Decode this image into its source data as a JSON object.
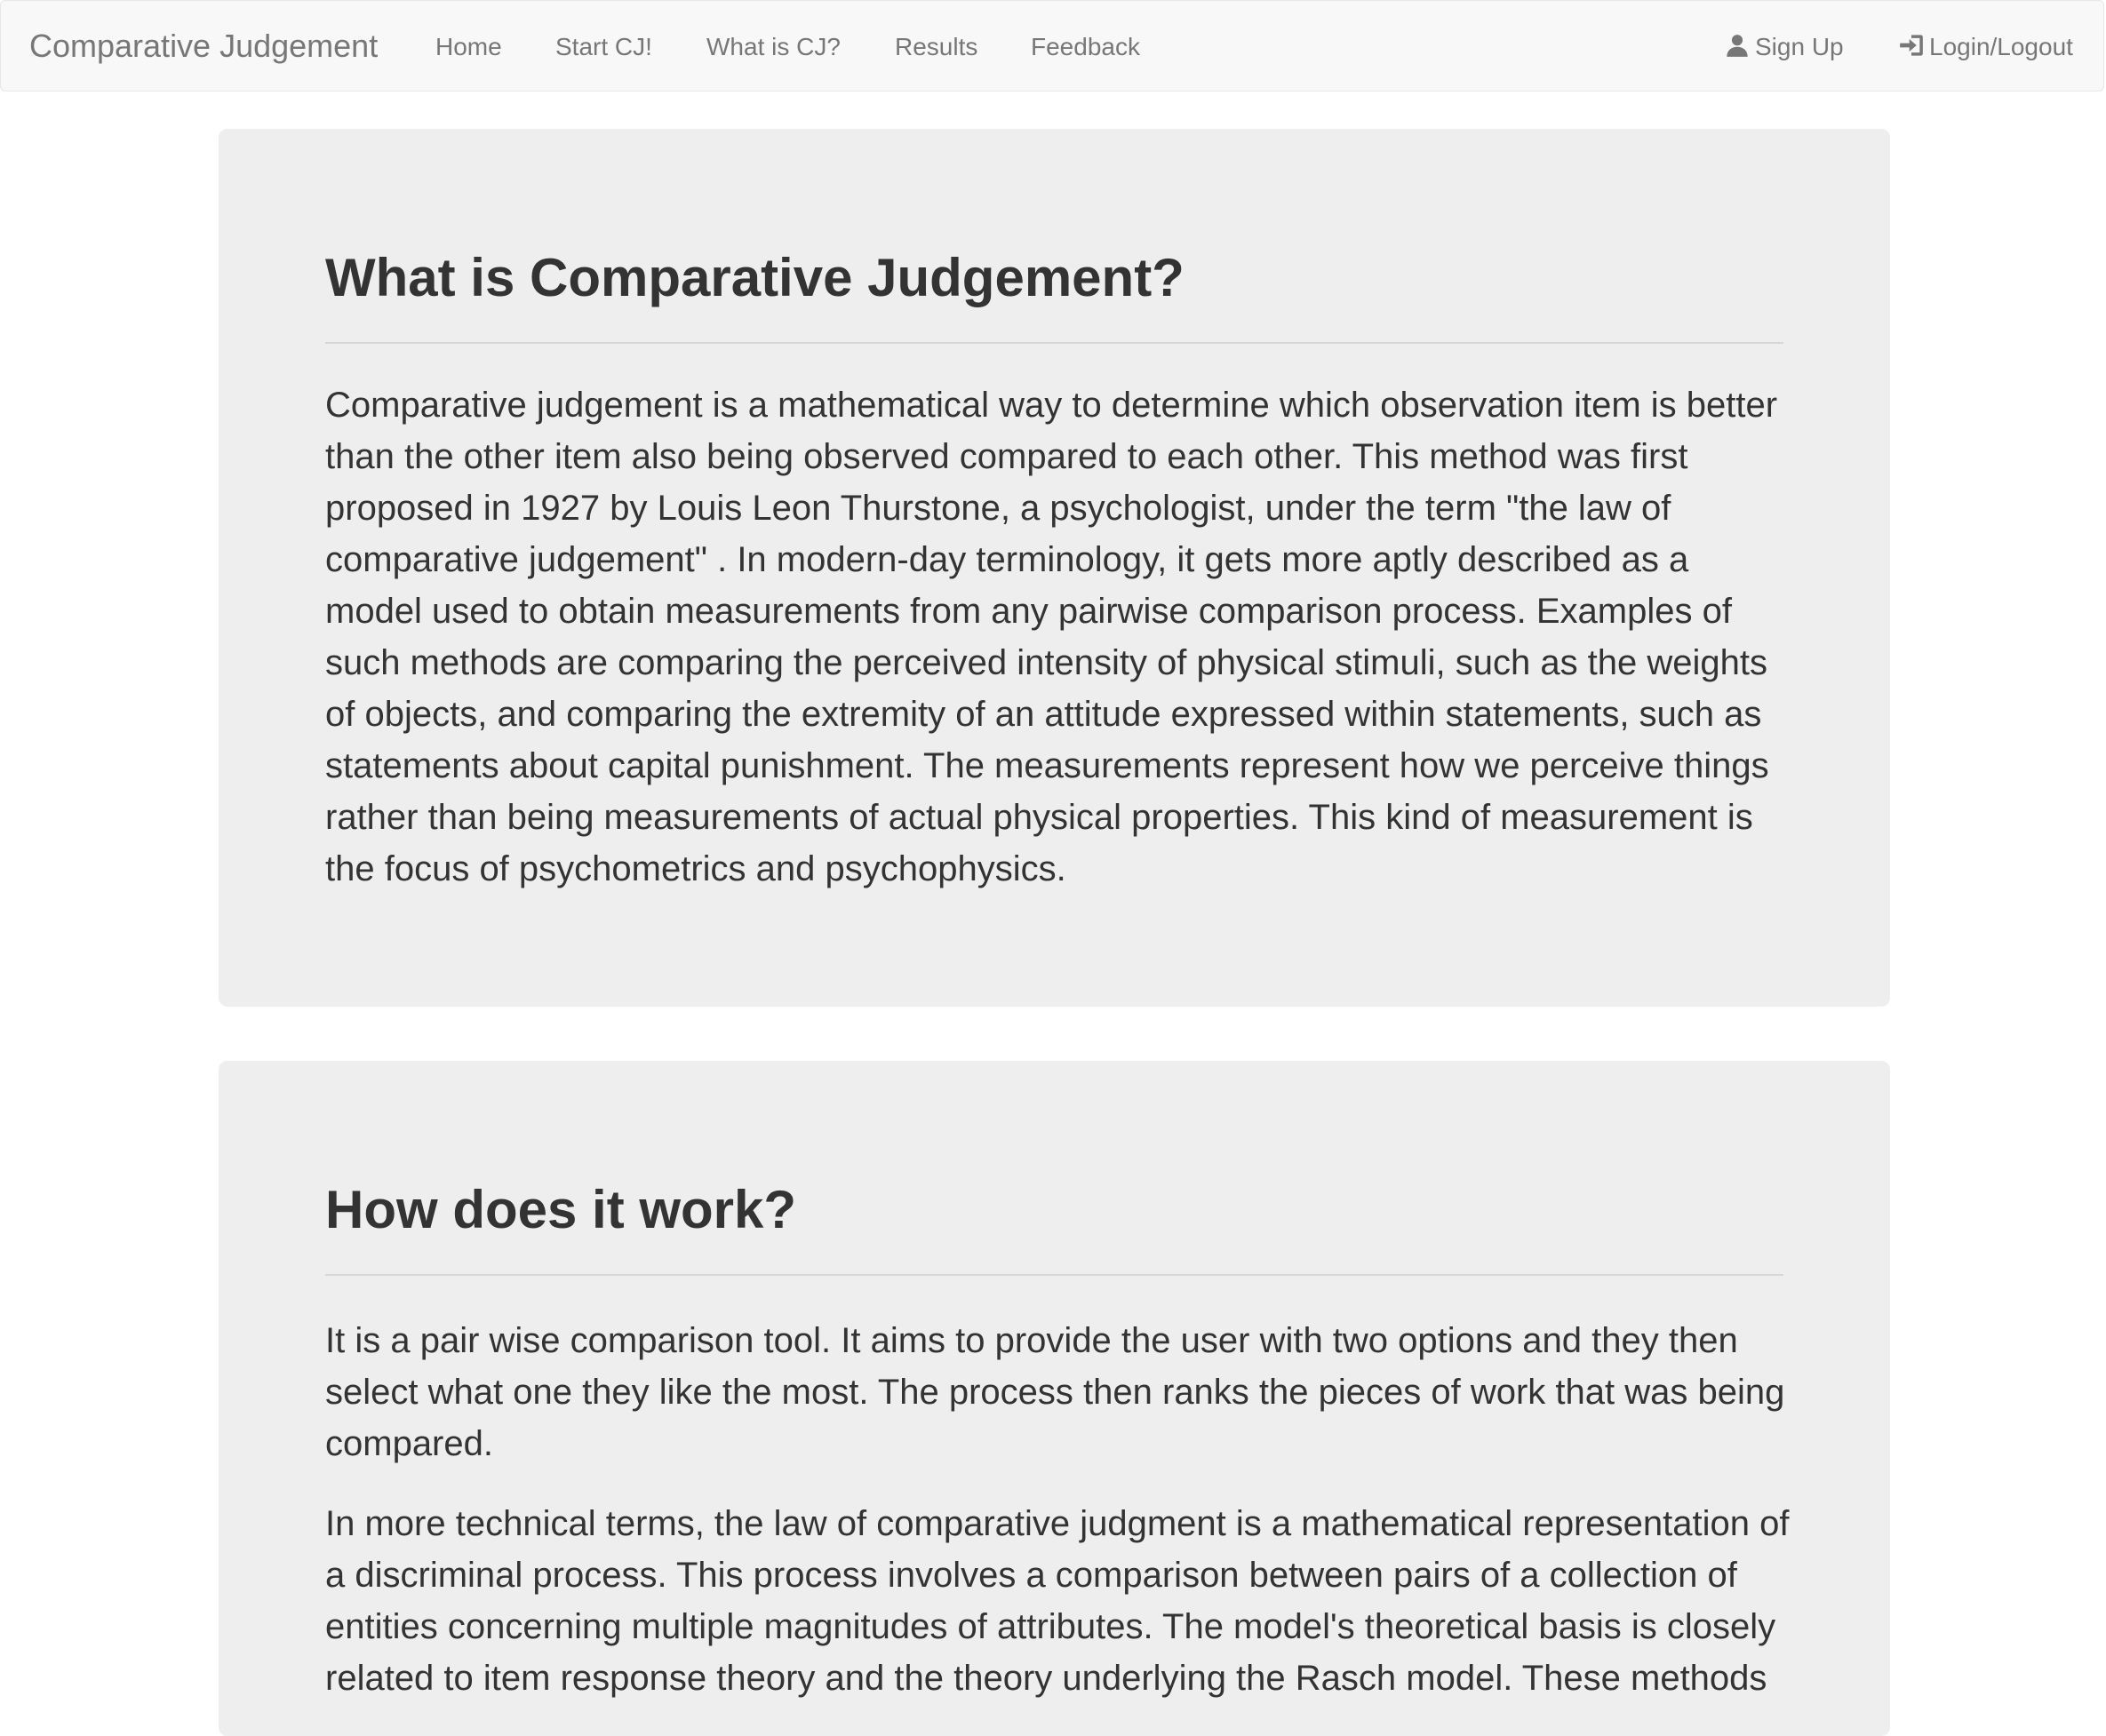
{
  "navbar": {
    "brand": "Comparative Judgement",
    "items": [
      {
        "label": "Home"
      },
      {
        "label": "Start CJ!"
      },
      {
        "label": "What is CJ?"
      },
      {
        "label": "Results"
      },
      {
        "label": "Feedback"
      }
    ],
    "sign_up": {
      "label": "Sign Up",
      "icon": "user-icon"
    },
    "login": {
      "label": "Login/Logout",
      "icon": "log-in-icon"
    }
  },
  "section1": {
    "title": "What is Comparative Judgement?",
    "paragraph": "Comparative judgement is a mathematical way to determine which observation item is better than the other item also being observed compared to each other. This method was first proposed in 1927 by Louis Leon Thurstone, a psychologist, under the term \"the law of comparative judgement\" . In modern-day terminology, it gets more aptly described as a model used to obtain measurements from any pairwise comparison process. Examples of such methods are comparing the perceived intensity of physical stimuli, such as the weights of objects, and comparing the extremity of an attitude expressed within statements, such as statements about capital punishment. The measurements represent how we perceive things rather than being measurements of actual physical properties. This kind of measurement is the focus of psychometrics and psychophysics."
  },
  "section2": {
    "title": "How does it work?",
    "paragraph1": "It is a pair wise comparison tool. It aims to provide the user with two options and they then select what one they like the most. The process then ranks the pieces of work that was being compared.",
    "paragraph2": "In more technical terms, the law of comparative judgment is a mathematical representation of a discriminal process. This process involves a comparison between pairs of a collection of entities concerning multiple magnitudes of attributes. The model's theoretical basis is closely related to item response theory and the theory underlying the Rasch model. These methods"
  }
}
